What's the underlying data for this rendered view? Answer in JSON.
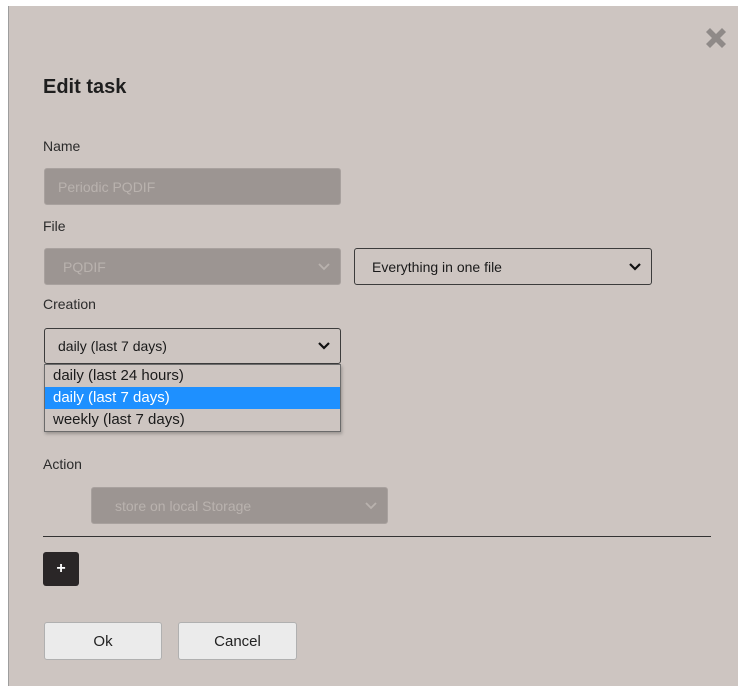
{
  "dialog": {
    "title": "Edit task",
    "close_icon": "close-x-icon"
  },
  "name": {
    "label": "Name",
    "value": "Periodic PQDIF"
  },
  "file": {
    "label": "File",
    "format_value": "PQDIF",
    "split_value": "Everything in one file"
  },
  "creation": {
    "label": "Creation",
    "selected": "daily (last 7 days)",
    "options": [
      "daily (last 24 hours)",
      "daily (last 7 days)",
      "weekly (last 7 days)"
    ]
  },
  "action": {
    "label": "Action",
    "value": "store on local Storage"
  },
  "add_button_label": "+",
  "buttons": {
    "ok": "Ok",
    "cancel": "Cancel"
  },
  "colors": {
    "dialog_bg": "#cdc5c1",
    "selected_option": "#1e90ff",
    "add_button_bg": "#2a2627"
  }
}
